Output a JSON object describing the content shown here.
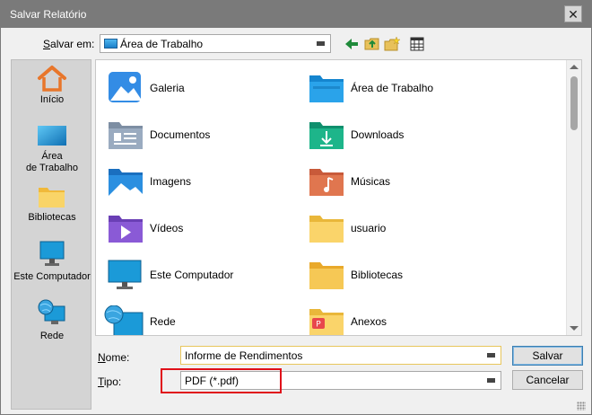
{
  "window": {
    "title": "Salvar Relatório"
  },
  "savein": {
    "label_pre": "",
    "label_key": "S",
    "label_post": "alvar em:",
    "location": "Área de Trabalho"
  },
  "places": [
    {
      "label_line1": "Início",
      "label_line2": "",
      "icon": "home-icon"
    },
    {
      "label_line1": "Área",
      "label_line2": "de Trabalho",
      "icon": "desktop-icon"
    },
    {
      "label_line1": "Bibliotecas",
      "label_line2": "",
      "icon": "libraries-icon"
    },
    {
      "label_line1": "Este Computador",
      "label_line2": "",
      "icon": "computer-icon"
    },
    {
      "label_line1": "Rede",
      "label_line2": "",
      "icon": "network-icon"
    }
  ],
  "files": [
    {
      "name": "Galeria",
      "icon": "gallery-icon"
    },
    {
      "name": "Área de Trabalho",
      "icon": "desktop-folder-icon"
    },
    {
      "name": "Documentos",
      "icon": "documents-folder-icon"
    },
    {
      "name": "Downloads",
      "icon": "downloads-folder-icon"
    },
    {
      "name": "Imagens",
      "icon": "pictures-folder-icon"
    },
    {
      "name": "Músicas",
      "icon": "music-folder-icon"
    },
    {
      "name": "Vídeos",
      "icon": "videos-folder-icon"
    },
    {
      "name": "usuario",
      "icon": "user-folder-icon"
    },
    {
      "name": "Este Computador",
      "icon": "computer-icon"
    },
    {
      "name": "Bibliotecas",
      "icon": "libraries-folder-icon"
    },
    {
      "name": "Rede",
      "icon": "network-icon"
    },
    {
      "name": "Anexos",
      "icon": "attachments-folder-icon"
    }
  ],
  "filename": {
    "label_key": "N",
    "label_post": "ome:",
    "value": "Informe de Rendimentos"
  },
  "filetype": {
    "label_key": "T",
    "label_post": "ipo:",
    "value": "PDF (*.pdf)"
  },
  "buttons": {
    "save": "Salvar",
    "cancel": "Cancelar"
  },
  "colors": {
    "highlight": "#e0101a",
    "titlebar": "#7a7a7a"
  }
}
